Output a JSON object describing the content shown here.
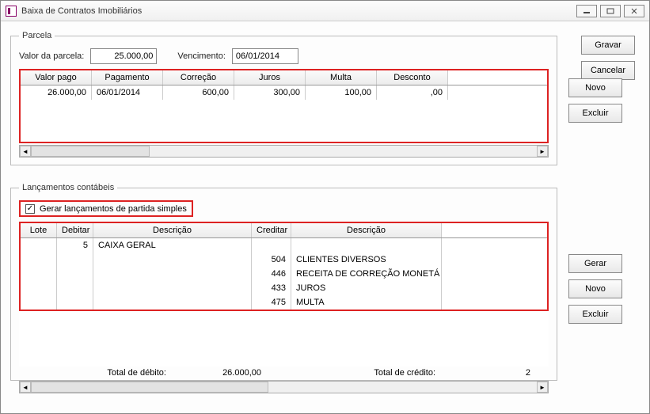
{
  "window": {
    "title": "Baixa de Contratos Imobiliários"
  },
  "buttons": {
    "gravar": "Gravar",
    "cancelar": "Cancelar",
    "novo": "Novo",
    "excluir": "Excluir",
    "gerar": "Gerar"
  },
  "parcela": {
    "legend": "Parcela",
    "valor_label": "Valor da parcela:",
    "valor_value": "25.000,00",
    "venc_label": "Vencimento:",
    "venc_value": "06/01/2014",
    "grid": {
      "headers": {
        "valor_pago": "Valor pago",
        "pagamento": "Pagamento",
        "correcao": "Correção",
        "juros": "Juros",
        "multa": "Multa",
        "desconto": "Desconto"
      },
      "row": {
        "valor_pago": "26.000,00",
        "pagamento": "06/01/2014",
        "correcao": "600,00",
        "juros": "300,00",
        "multa": "100,00",
        "desconto": ",00"
      }
    }
  },
  "lanc": {
    "legend": "Lançamentos contábeis",
    "check_label": "Gerar lançamentos de partida simples",
    "check_checked": "✓",
    "grid": {
      "headers": {
        "lote": "Lote",
        "debitar": "Debitar",
        "descricao1": "Descrição",
        "creditar": "Creditar",
        "descricao2": "Descrição"
      },
      "rows": [
        {
          "lote": "",
          "debitar": "5",
          "desc1": "CAIXA GERAL",
          "creditar": "",
          "desc2": ""
        },
        {
          "lote": "",
          "debitar": "",
          "desc1": "",
          "creditar": "504",
          "desc2": "CLIENTES DIVERSOS"
        },
        {
          "lote": "",
          "debitar": "",
          "desc1": "",
          "creditar": "446",
          "desc2": "RECEITA DE CORREÇÃO MONETÁ"
        },
        {
          "lote": "",
          "debitar": "",
          "desc1": "",
          "creditar": "433",
          "desc2": "JUROS"
        },
        {
          "lote": "",
          "debitar": "",
          "desc1": "",
          "creditar": "475",
          "desc2": "MULTA"
        }
      ]
    },
    "totals": {
      "debito_label": "Total de débito:",
      "debito_value": "26.000,00",
      "credito_label": "Total de crédito:",
      "credito_value": "2"
    }
  }
}
